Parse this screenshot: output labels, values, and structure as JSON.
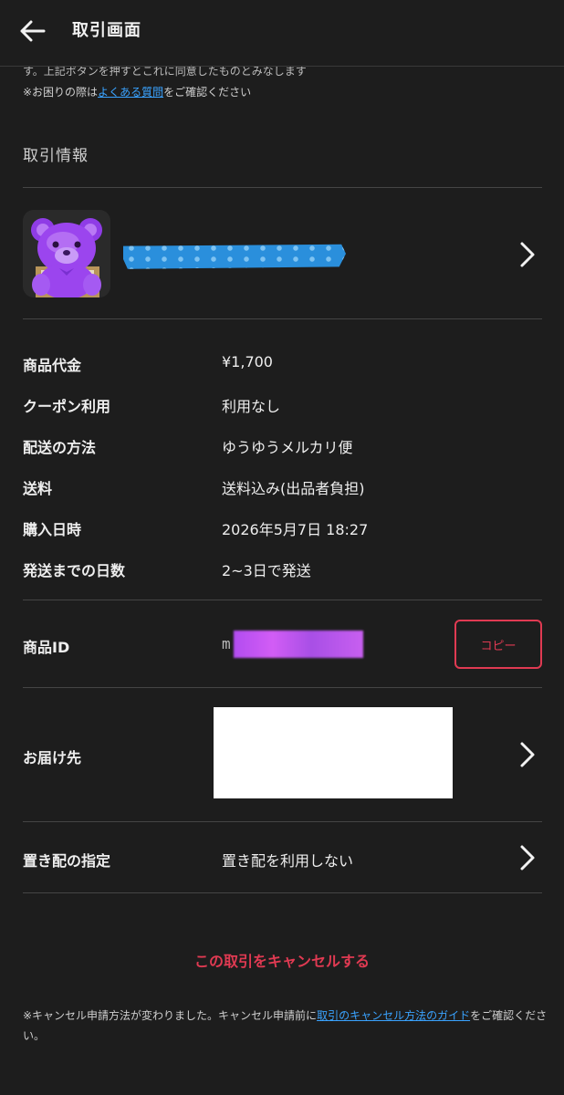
{
  "header": {
    "title": "取引画面",
    "back_icon": "arrow-left-icon"
  },
  "notice": {
    "line1": "す。上記ボタンを押すとこれに同意したものとみなします",
    "line2_prefix": "※お困りの際は",
    "line2_link": "よくある質問",
    "line2_suffix": "をご確認ください"
  },
  "transaction": {
    "section_title": "取引情報",
    "items": [
      {
        "label": "商品代金",
        "value": "¥1,700"
      },
      {
        "label": "クーポン利用",
        "value": "利用なし"
      },
      {
        "label": "配送の方法",
        "value": "ゆうゆうメルカリ便"
      },
      {
        "label": "送料",
        "value": "送料込み(出品者負担)"
      },
      {
        "label": "購入日時",
        "value": "2026年5月7日 18:27"
      },
      {
        "label": "発送までの日数",
        "value": "2~3日で発送"
      }
    ],
    "product_id": {
      "label": "商品ID",
      "value_prefix": "m",
      "copy_label": "コピー"
    },
    "delivery_address": {
      "label": "お届け先"
    },
    "placement": {
      "label": "置き配の指定",
      "value": "置き配を利用しない"
    }
  },
  "cancel": {
    "label": "この取引をキャンセルする"
  },
  "footer": {
    "prefix": "※キャンセル申請方法が変わりました。キャンセル申請前に",
    "link": "取引のキャンセル方法のガイド",
    "suffix": "をご確認ください。"
  },
  "colors": {
    "background": "#1d1d1d",
    "accent_red": "#e03a52",
    "link_blue": "#3aa3ff"
  }
}
